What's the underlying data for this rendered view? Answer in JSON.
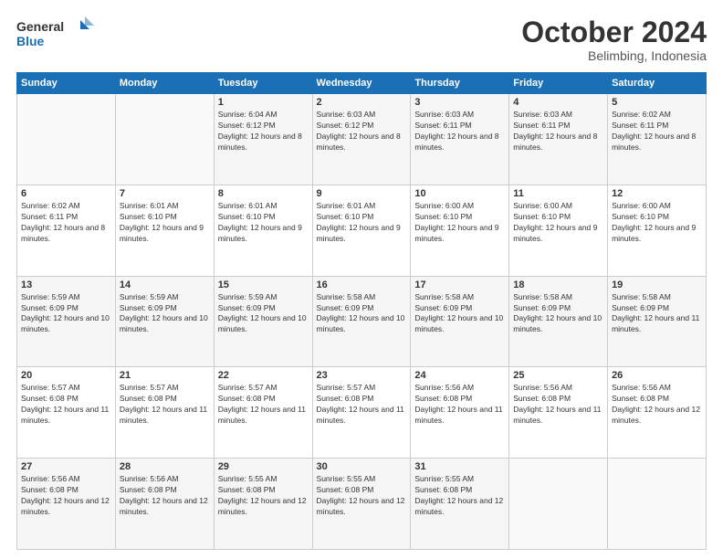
{
  "logo": {
    "line1": "General",
    "line2": "Blue",
    "icon_color": "#1a6fb5"
  },
  "header": {
    "title": "October 2024",
    "subtitle": "Belimbing, Indonesia"
  },
  "weekdays": [
    "Sunday",
    "Monday",
    "Tuesday",
    "Wednesday",
    "Thursday",
    "Friday",
    "Saturday"
  ],
  "weeks": [
    [
      {
        "day": "",
        "info": ""
      },
      {
        "day": "",
        "info": ""
      },
      {
        "day": "1",
        "info": "Sunrise: 6:04 AM\nSunset: 6:12 PM\nDaylight: 12 hours and 8 minutes."
      },
      {
        "day": "2",
        "info": "Sunrise: 6:03 AM\nSunset: 6:12 PM\nDaylight: 12 hours and 8 minutes."
      },
      {
        "day": "3",
        "info": "Sunrise: 6:03 AM\nSunset: 6:11 PM\nDaylight: 12 hours and 8 minutes."
      },
      {
        "day": "4",
        "info": "Sunrise: 6:03 AM\nSunset: 6:11 PM\nDaylight: 12 hours and 8 minutes."
      },
      {
        "day": "5",
        "info": "Sunrise: 6:02 AM\nSunset: 6:11 PM\nDaylight: 12 hours and 8 minutes."
      }
    ],
    [
      {
        "day": "6",
        "info": "Sunrise: 6:02 AM\nSunset: 6:11 PM\nDaylight: 12 hours and 8 minutes."
      },
      {
        "day": "7",
        "info": "Sunrise: 6:01 AM\nSunset: 6:10 PM\nDaylight: 12 hours and 9 minutes."
      },
      {
        "day": "8",
        "info": "Sunrise: 6:01 AM\nSunset: 6:10 PM\nDaylight: 12 hours and 9 minutes."
      },
      {
        "day": "9",
        "info": "Sunrise: 6:01 AM\nSunset: 6:10 PM\nDaylight: 12 hours and 9 minutes."
      },
      {
        "day": "10",
        "info": "Sunrise: 6:00 AM\nSunset: 6:10 PM\nDaylight: 12 hours and 9 minutes."
      },
      {
        "day": "11",
        "info": "Sunrise: 6:00 AM\nSunset: 6:10 PM\nDaylight: 12 hours and 9 minutes."
      },
      {
        "day": "12",
        "info": "Sunrise: 6:00 AM\nSunset: 6:10 PM\nDaylight: 12 hours and 9 minutes."
      }
    ],
    [
      {
        "day": "13",
        "info": "Sunrise: 5:59 AM\nSunset: 6:09 PM\nDaylight: 12 hours and 10 minutes."
      },
      {
        "day": "14",
        "info": "Sunrise: 5:59 AM\nSunset: 6:09 PM\nDaylight: 12 hours and 10 minutes."
      },
      {
        "day": "15",
        "info": "Sunrise: 5:59 AM\nSunset: 6:09 PM\nDaylight: 12 hours and 10 minutes."
      },
      {
        "day": "16",
        "info": "Sunrise: 5:58 AM\nSunset: 6:09 PM\nDaylight: 12 hours and 10 minutes."
      },
      {
        "day": "17",
        "info": "Sunrise: 5:58 AM\nSunset: 6:09 PM\nDaylight: 12 hours and 10 minutes."
      },
      {
        "day": "18",
        "info": "Sunrise: 5:58 AM\nSunset: 6:09 PM\nDaylight: 12 hours and 10 minutes."
      },
      {
        "day": "19",
        "info": "Sunrise: 5:58 AM\nSunset: 6:09 PM\nDaylight: 12 hours and 11 minutes."
      }
    ],
    [
      {
        "day": "20",
        "info": "Sunrise: 5:57 AM\nSunset: 6:08 PM\nDaylight: 12 hours and 11 minutes."
      },
      {
        "day": "21",
        "info": "Sunrise: 5:57 AM\nSunset: 6:08 PM\nDaylight: 12 hours and 11 minutes."
      },
      {
        "day": "22",
        "info": "Sunrise: 5:57 AM\nSunset: 6:08 PM\nDaylight: 12 hours and 11 minutes."
      },
      {
        "day": "23",
        "info": "Sunrise: 5:57 AM\nSunset: 6:08 PM\nDaylight: 12 hours and 11 minutes."
      },
      {
        "day": "24",
        "info": "Sunrise: 5:56 AM\nSunset: 6:08 PM\nDaylight: 12 hours and 11 minutes."
      },
      {
        "day": "25",
        "info": "Sunrise: 5:56 AM\nSunset: 6:08 PM\nDaylight: 12 hours and 11 minutes."
      },
      {
        "day": "26",
        "info": "Sunrise: 5:56 AM\nSunset: 6:08 PM\nDaylight: 12 hours and 12 minutes."
      }
    ],
    [
      {
        "day": "27",
        "info": "Sunrise: 5:56 AM\nSunset: 6:08 PM\nDaylight: 12 hours and 12 minutes."
      },
      {
        "day": "28",
        "info": "Sunrise: 5:56 AM\nSunset: 6:08 PM\nDaylight: 12 hours and 12 minutes."
      },
      {
        "day": "29",
        "info": "Sunrise: 5:55 AM\nSunset: 6:08 PM\nDaylight: 12 hours and 12 minutes."
      },
      {
        "day": "30",
        "info": "Sunrise: 5:55 AM\nSunset: 6:08 PM\nDaylight: 12 hours and 12 minutes."
      },
      {
        "day": "31",
        "info": "Sunrise: 5:55 AM\nSunset: 6:08 PM\nDaylight: 12 hours and 12 minutes."
      },
      {
        "day": "",
        "info": ""
      },
      {
        "day": "",
        "info": ""
      }
    ]
  ]
}
